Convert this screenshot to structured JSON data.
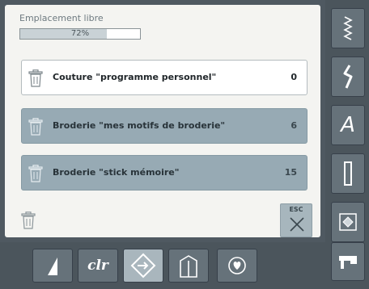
{
  "free_space": {
    "label": "Emplacement libre",
    "percent_text": "72%",
    "percent": 72
  },
  "memory_rows": [
    {
      "label": "Couture \"programme personnel\"",
      "count": "0",
      "icon": "trash-icon",
      "selected": false
    },
    {
      "label": "Broderie \"mes motifs de broderie\"",
      "count": "6",
      "icon": "trash-icon",
      "selected": true
    },
    {
      "label": "Broderie \"stick mémoire\"",
      "count": "15",
      "icon": "trash-icon",
      "selected": true
    }
  ],
  "esc_button": {
    "label": "ESC",
    "icon": "close-x-icon"
  },
  "bottom_bar": [
    {
      "name": "scissors-icon"
    },
    {
      "name": "clr-button",
      "label": "clr"
    },
    {
      "name": "navigate-icon",
      "active": true
    },
    {
      "name": "memory-icon"
    },
    {
      "name": "heart-icon"
    }
  ],
  "side_bar": [
    {
      "name": "zigzag-stitch-icon"
    },
    {
      "name": "decorative-stitch-icon"
    },
    {
      "name": "alphabet-button",
      "label": "A"
    },
    {
      "name": "buttonhole-icon"
    },
    {
      "name": "quilt-stitch-icon"
    },
    {
      "name": "sewing-machine-icon"
    }
  ],
  "colors": {
    "panel_bg": "#f4f4f1",
    "row_selected": "#97aab4",
    "chrome": "#4b555c"
  }
}
